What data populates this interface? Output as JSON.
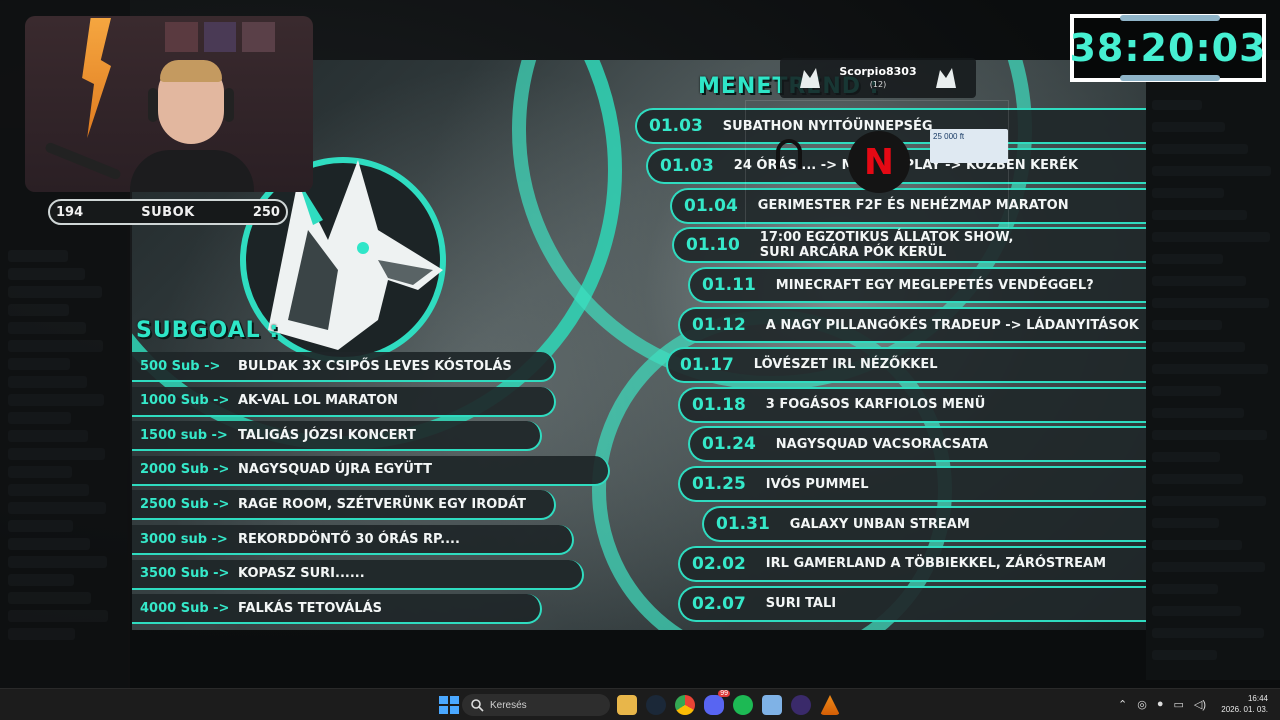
{
  "webcam": {
    "sub_bar": {
      "current": "194",
      "label": "SUBOK",
      "goal": "250"
    }
  },
  "timer": {
    "value": "38:20:03"
  },
  "alert": {
    "username": "Scorpio8303",
    "count": "(12)",
    "reward_amount": "25 000 ft"
  },
  "board": {
    "subgoal_title": "SUBGOAL :",
    "schedule_title": "MENETREND :",
    "accent_color": "#35e8c9",
    "subgoals": [
      {
        "amount": "500 Sub ->",
        "text": "BULDAK 3X CSIPŐS LEVES KÓSTOLÁS"
      },
      {
        "amount": "1000 Sub ->",
        "text": "AK-VAL LOL MARATON"
      },
      {
        "amount": "1500 sub ->",
        "text": "TALIGÁS JÓZSI KONCERT"
      },
      {
        "amount": "2000 Sub ->",
        "text": "NAGYSQUAD ÚJRA EGYÜTT"
      },
      {
        "amount": "2500 Sub ->",
        "text": "RAGE ROOM, SZÉTVERÜNK EGY IRODÁT"
      },
      {
        "amount": "3000 sub ->",
        "text": "REKORDDÖNTŐ 30 ÓRÁS RP...."
      },
      {
        "amount": "3500 Sub ->",
        "text": "KOPASZ SURI......"
      },
      {
        "amount": "4000 Sub ->",
        "text": "FALKÁS TETOVÁLÁS"
      }
    ],
    "schedule": [
      {
        "date": "01.03",
        "event": "SUBATHON NYITÓÜNNEPSÉG"
      },
      {
        "date": "01.03",
        "event": "24 ÓRÁS ... -> MA... OSPLAY -> KÖZBEN KERÉK"
      },
      {
        "date": "01.04",
        "event": "GERIMESTER F2F ÉS NEHÉZMAP MARATON"
      },
      {
        "date": "01.10",
        "event": "17:00 EGZOTIKUS ÁLLATOK SHOW,\nSURI ARCÁRA PÓK KERÜL"
      },
      {
        "date": "01.11",
        "event": "MINECRAFT EGY MEGLEPETÉS VENDÉGGEL?"
      },
      {
        "date": "01.12",
        "event": "A NAGY PILLANGÓKÉS TRADEUP -> LÁDANYITÁSOK"
      },
      {
        "date": "01.17",
        "event": "LÖVÉSZET IRL NÉZŐKKEL"
      },
      {
        "date": "01.18",
        "event": "3 FOGÁSOS KARFIOLOS MENÜ"
      },
      {
        "date": "01.24",
        "event": "NAGYSQUAD VACSORACSATA"
      },
      {
        "date": "01.25",
        "event": "IVÓS PUMMEL"
      },
      {
        "date": "01.31",
        "event": "GALAXY UNBAN STREAM"
      },
      {
        "date": "02.02",
        "event": "IRL GAMERLAND A TÖBBIEKKEL, ZÁRÓSTREAM"
      },
      {
        "date": "02.07",
        "event": "SURI TALI"
      }
    ]
  },
  "taskbar": {
    "search_placeholder": "Keresés",
    "icons": [
      "windows-start-icon",
      "file-explorer-icon",
      "steam-icon",
      "chrome-icon",
      "discord-icon",
      "spotify-icon",
      "notepad-icon",
      "app-icon",
      "vlc-icon"
    ],
    "discord_badge": "99",
    "clock_time": "16:44",
    "clock_date": "2026. 01. 03."
  }
}
